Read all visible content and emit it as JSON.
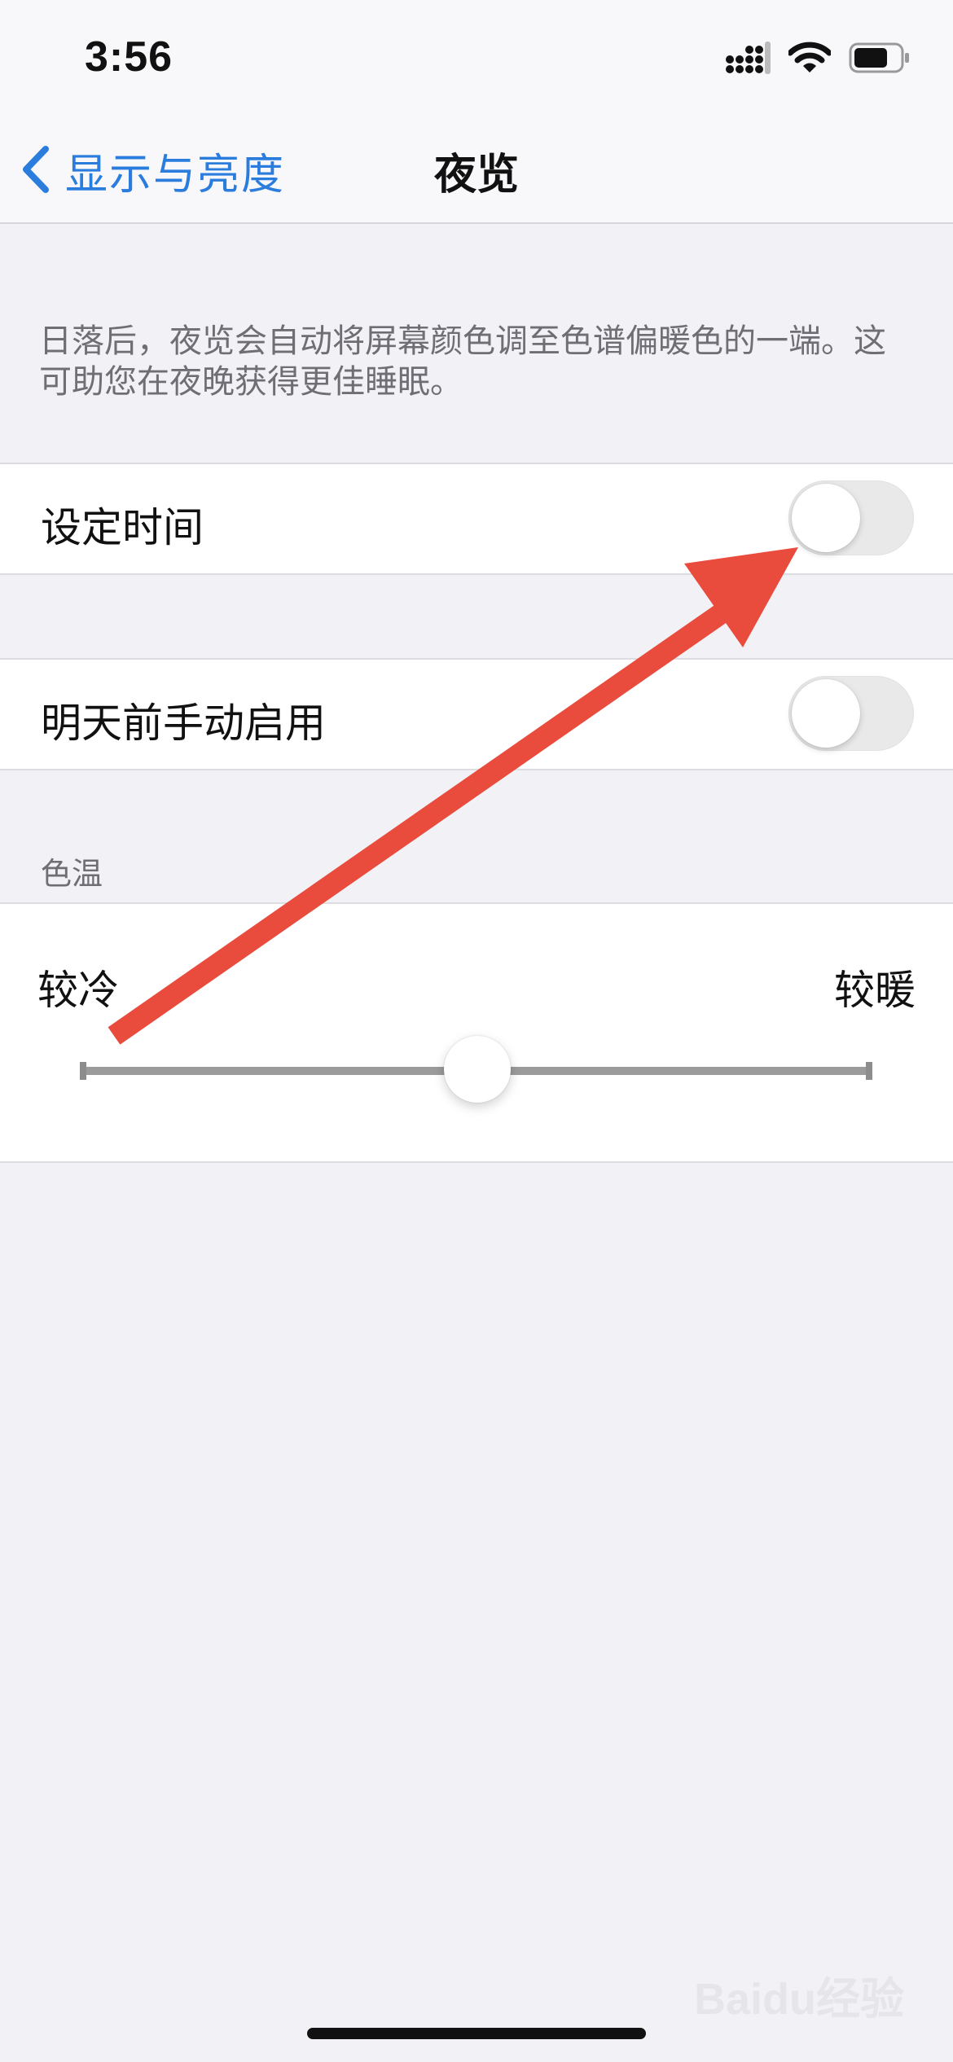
{
  "status_bar": {
    "time": "3:56",
    "icons": [
      "cellular-signal-icon",
      "wifi-icon",
      "battery-icon"
    ]
  },
  "nav": {
    "back_label": "显示与亮度",
    "title": "夜览"
  },
  "description": "日落后，夜览会自动将屏幕颜色调至色谱偏暖色的一端。这可助您在夜晚获得更佳睡眠。",
  "rows": [
    {
      "label": "设定时间",
      "toggle_on": false
    },
    {
      "label": "明天前手动启用",
      "toggle_on": false
    }
  ],
  "color_temperature": {
    "header": "色温",
    "min_label": "较冷",
    "max_label": "较暖",
    "value_fraction": 0.5
  },
  "watermark": "Baidu经验",
  "colors": {
    "accent_blue": "#2a7cdd",
    "annotation_red": "#e94b3c",
    "background": "#f2f1f6"
  }
}
